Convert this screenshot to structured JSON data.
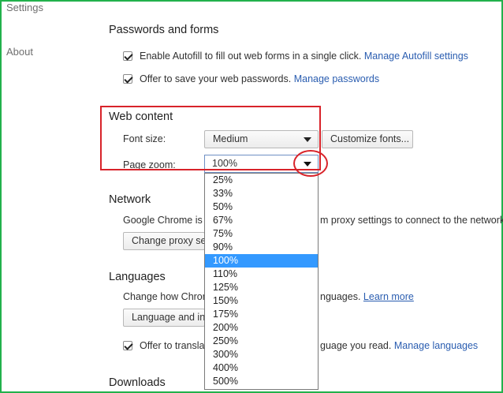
{
  "sidebar": {
    "settings_label": "Settings",
    "about_label": "About"
  },
  "passwords": {
    "title": "Passwords and forms",
    "autofill_text": "Enable Autofill to fill out web forms in a single click.",
    "autofill_link": "Manage Autofill settings",
    "save_pw_text": "Offer to save your web passwords.",
    "save_pw_link": "Manage passwords"
  },
  "web_content": {
    "title": "Web content",
    "font_size_label": "Font size:",
    "font_size_value": "Medium",
    "customize_fonts_label": "Customize fonts...",
    "page_zoom_label": "Page zoom:",
    "page_zoom_value": "100%"
  },
  "zoom_options": [
    "25%",
    "33%",
    "50%",
    "67%",
    "75%",
    "90%",
    "100%",
    "110%",
    "125%",
    "150%",
    "175%",
    "200%",
    "250%",
    "300%",
    "400%",
    "500%"
  ],
  "zoom_selected_index": 6,
  "network": {
    "title": "Network",
    "desc_left": "Google Chrome is u",
    "desc_right": "m proxy settings to connect to the network.",
    "proxy_button_label": "Change proxy set"
  },
  "languages": {
    "title": "Languages",
    "desc_left": "Change how Chrom",
    "desc_right": "nguages.",
    "learn_more_link": "Learn more",
    "lang_button_label": "Language and inp",
    "translate_left": "Offer to translat",
    "translate_right": "guage you read.",
    "manage_languages_link": "Manage languages"
  },
  "downloads": {
    "title": "Downloads"
  },
  "colors": {
    "annotation_red": "#d8232a",
    "frame_green": "#22b14c",
    "link_blue": "#2a5db0",
    "selected_blue": "#3399ff"
  }
}
